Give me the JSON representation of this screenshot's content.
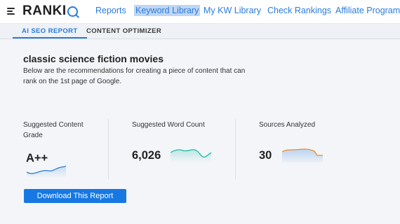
{
  "brand": {
    "logo_text": "RANKI",
    "accent": "#2a7bdc"
  },
  "nav": {
    "links": [
      "Reports",
      "Keyword Library",
      "My KW Library",
      "Check Rankings",
      "Affiliate Program"
    ],
    "selected": "Keyword Library"
  },
  "tabs": [
    {
      "label": "AI SEO REPORT",
      "active": true
    },
    {
      "label": "CONTENT OPTIMIZER",
      "active": false
    }
  ],
  "report": {
    "title": "classic science fiction movies",
    "description": "Below are the recommendations for creating a piece of content that can rank on the 1st page of Google."
  },
  "stats": {
    "grade": {
      "label": "Suggested Content Grade",
      "value": "A++"
    },
    "word_count": {
      "label": "Suggested Word Count",
      "value": "6,026"
    },
    "sources": {
      "label": "Sources Analyzed",
      "value": "30"
    }
  },
  "download_label": "Download This Report"
}
